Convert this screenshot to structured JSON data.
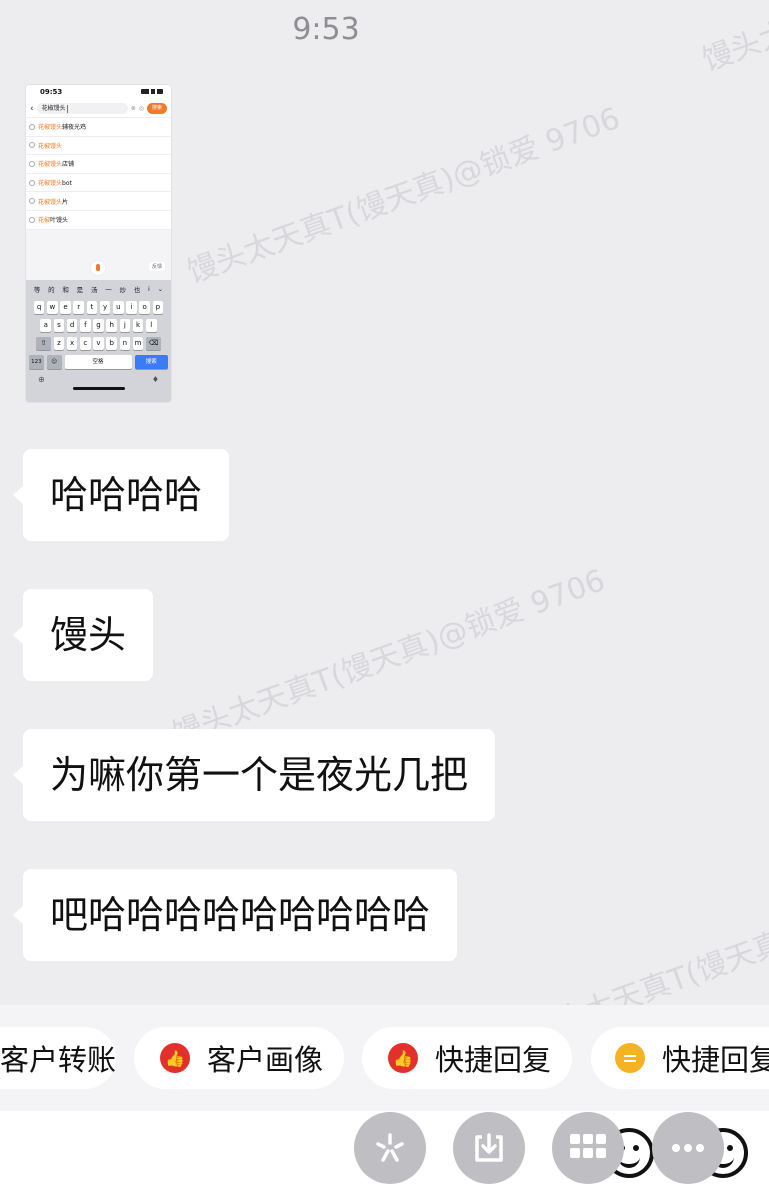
{
  "status_bar": {
    "time": "9:53"
  },
  "watermark": "馒头太天真T(馒天真)@锁爱 9706",
  "thumbnail": {
    "time": "09:53",
    "search_text": "花椒馒头",
    "search_button": "搜索",
    "suggestions": [
      {
        "hl": "花椒馒头",
        "rest": "辅夜光鸡"
      },
      {
        "hl": "花椒馒头",
        "rest": ""
      },
      {
        "hl": "花椒馒头",
        "rest": "店铺"
      },
      {
        "hl": "花椒馒头",
        "rest": "bot"
      },
      {
        "hl": "花椒馒头",
        "rest": "片"
      },
      {
        "hl": "花椒",
        "rest": "叶馒头"
      }
    ],
    "feedback": "反馈",
    "candidates": [
      "等",
      "的",
      "和",
      "是",
      "汤",
      "一",
      "炒",
      "也",
      "i",
      "⌄"
    ],
    "row1": [
      "q",
      "w",
      "e",
      "r",
      "t",
      "y",
      "u",
      "i",
      "o",
      "p"
    ],
    "row2": [
      "a",
      "s",
      "d",
      "f",
      "g",
      "h",
      "j",
      "k",
      "l"
    ],
    "row3": [
      "z",
      "x",
      "c",
      "v",
      "b",
      "n",
      "m"
    ],
    "shift": "⇧",
    "backspace": "⌫",
    "key_123": "123",
    "key_emoji": "☺",
    "space": "空格",
    "search": "搜索",
    "globe": "⊕",
    "mic": "♦"
  },
  "messages": [
    {
      "text": "哈哈哈哈"
    },
    {
      "text": "馒头"
    },
    {
      "text": "为嘛你第一个是夜光几把"
    },
    {
      "text": "吧哈哈哈哈哈哈哈哈哈"
    }
  ],
  "quick_actions": [
    {
      "label": "客户转账",
      "icon": "none"
    },
    {
      "label": "客户画像",
      "icon": "thumbs-up-icon"
    },
    {
      "label": "快捷回复",
      "icon": "thumbs-up-icon"
    },
    {
      "label": "快捷回复",
      "icon": "message-icon"
    }
  ],
  "toolbar": {
    "buttons": [
      "sparkle-icon",
      "download-icon",
      "apps-grid-icon",
      "more-icon"
    ]
  }
}
